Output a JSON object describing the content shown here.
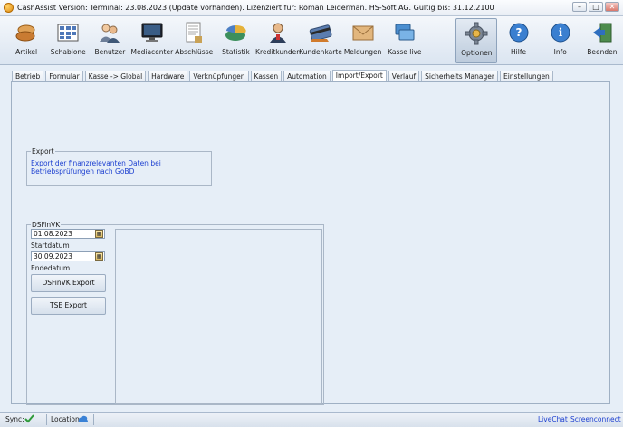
{
  "window": {
    "title": "CashAssist  Version: Terminal: 23.08.2023 (Update vorhanden).   Lizenziert für: Roman Leiderman. HS-Soft AG.   Gültig bis: 31.12.2100",
    "minimize": "–",
    "maximize": "□",
    "close": "✕"
  },
  "ribbon": {
    "items": [
      {
        "label": "Artikel",
        "icon": "bread-icon"
      },
      {
        "label": "Schablone",
        "icon": "grid-icon"
      },
      {
        "label": "Benutzer",
        "icon": "users-icon"
      },
      {
        "label": "Mediacenter",
        "icon": "monitor-icon"
      },
      {
        "label": "Abschlüsse",
        "icon": "document-icon"
      },
      {
        "label": "Statistik",
        "icon": "chart-icon"
      },
      {
        "label": "Kreditkunden",
        "icon": "customer-icon"
      },
      {
        "label": "Kundenkarte",
        "icon": "card-icon"
      },
      {
        "label": "Meldungen",
        "icon": "envelope-icon"
      },
      {
        "label": "Kasse live",
        "icon": "register-icon"
      },
      {
        "label": "Optionen",
        "icon": "gear-icon"
      },
      {
        "label": "Hilfe",
        "icon": "help-icon"
      },
      {
        "label": "Info",
        "icon": "info-icon"
      },
      {
        "label": "Beenden",
        "icon": "exit-icon"
      }
    ],
    "active": "Optionen"
  },
  "tabs": [
    "Betrieb",
    "Formular",
    "Kasse -> Global",
    "Hardware",
    "Verknüpfungen",
    "Kassen",
    "Automation",
    "Import/Export",
    "Verlauf",
    "Sicherheits Manager",
    "Einstellungen"
  ],
  "active_tab": "Import/Export",
  "export_group": {
    "legend": "Export",
    "link_text": "Export der finanzrelevanten Daten bei Betriebsprüfungen nach GoBD"
  },
  "dsfinvk_group": {
    "legend": "DSFinVK",
    "start_value": "01.08.2023",
    "start_label": "Startdatum",
    "end_value": "30.09.2023",
    "end_label": "Endedatum",
    "dsfinvk_button": "DSFinVK Export",
    "tse_button": "TSE Export"
  },
  "statusbar": {
    "sync_label": "Sync:",
    "location_label": "Location:",
    "livechat": "LiveChat",
    "screenconnect": "Screenconnect"
  },
  "colors": {
    "accent_link": "#1c3fd0",
    "panel_bg": "#e6eef7"
  }
}
